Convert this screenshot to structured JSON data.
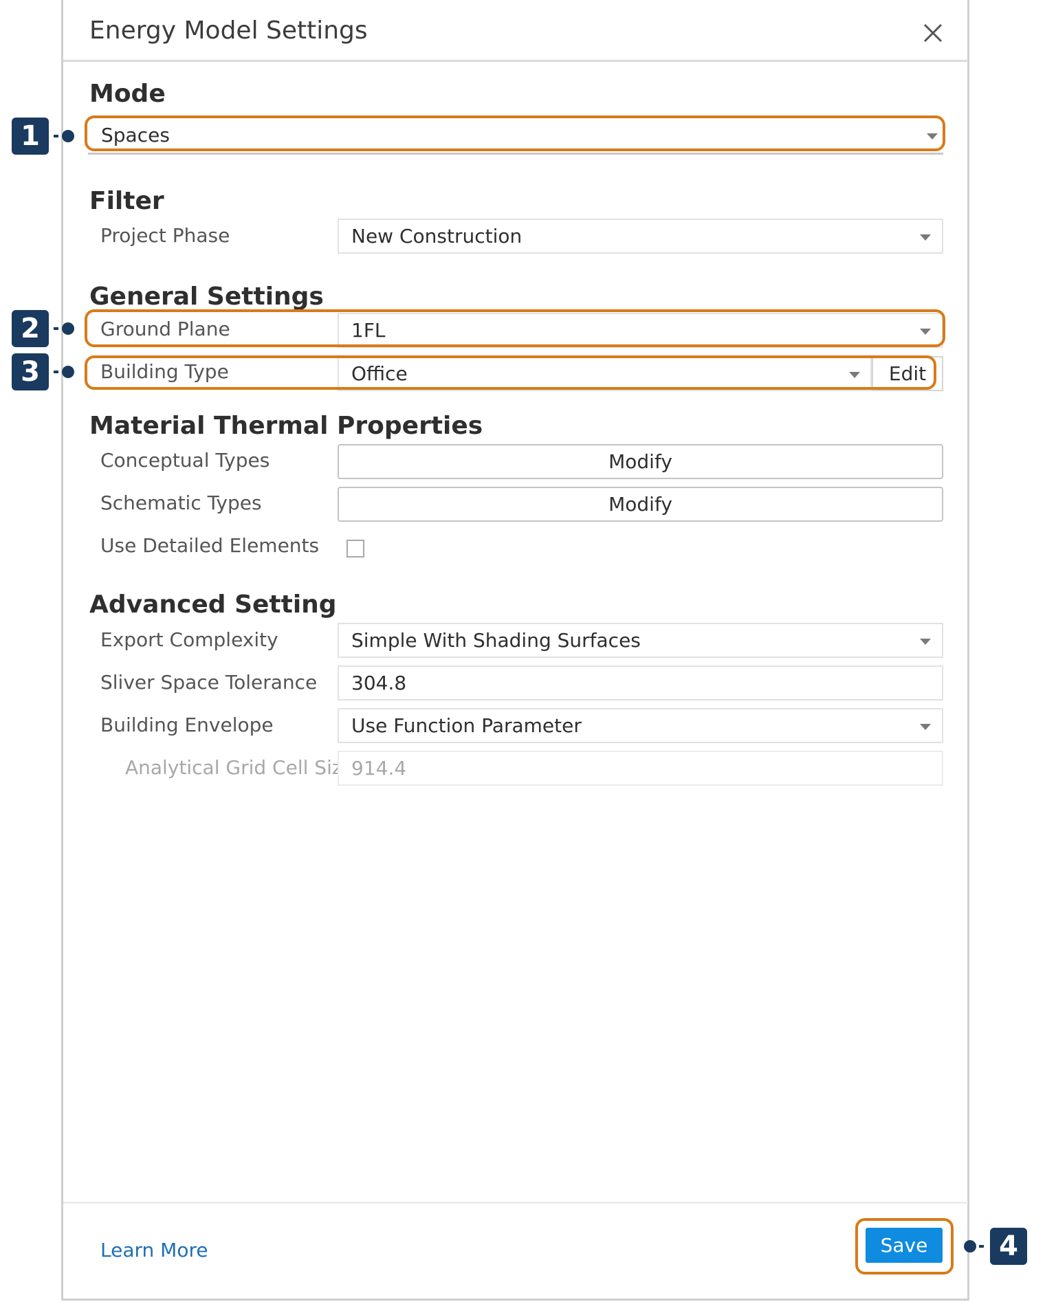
{
  "dialog": {
    "title": "Energy Model Settings"
  },
  "mode": {
    "heading": "Mode",
    "value": "Spaces"
  },
  "filter": {
    "heading": "Filter",
    "project_phase_label": "Project Phase",
    "project_phase_value": "New Construction"
  },
  "general": {
    "heading": "General Settings",
    "ground_plane_label": "Ground Plane",
    "ground_plane_value": "1FL",
    "building_type_label": "Building Type",
    "building_type_value": "Office",
    "edit_label": "Edit"
  },
  "material": {
    "heading": "Material Thermal Properties",
    "conceptual_label": "Conceptual Types",
    "conceptual_button": "Modify",
    "schematic_label": "Schematic Types",
    "schematic_button": "Modify",
    "detailed_label": "Use Detailed Elements",
    "detailed_checked": false
  },
  "advanced": {
    "heading": "Advanced Setting",
    "export_label": "Export Complexity",
    "export_value": "Simple With Shading Surfaces",
    "sliver_label": "Sliver Space Tolerance",
    "sliver_value": "304.8",
    "envelope_label": "Building Envelope",
    "envelope_value": "Use Function Parameter",
    "grid_label": "Analytical Grid Cell Size",
    "grid_value": "914.4"
  },
  "footer": {
    "learn_more": "Learn More",
    "save": "Save"
  },
  "callouts": [
    "1",
    "2",
    "3",
    "4"
  ],
  "colors": {
    "highlight": "#d77b19",
    "badge": "#1a3a5f",
    "primary": "#0f8be0",
    "link": "#1f6fb5"
  }
}
